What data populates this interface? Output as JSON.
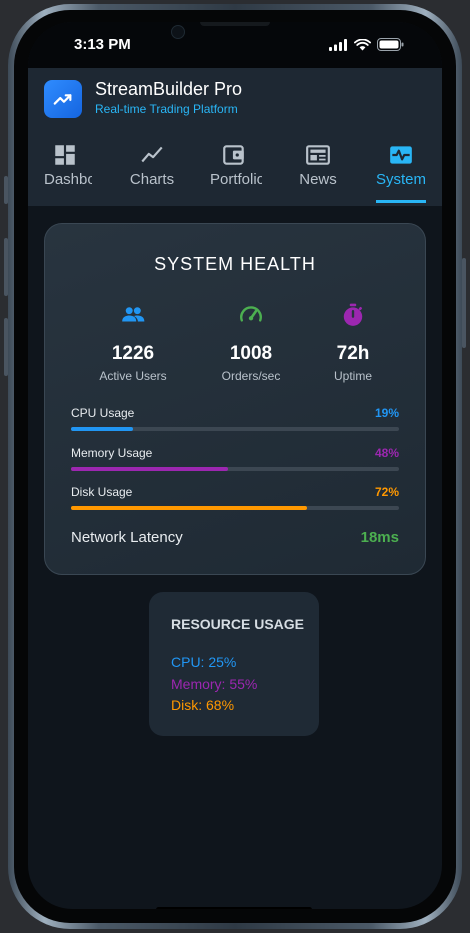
{
  "status_bar": {
    "time": "3:13 PM"
  },
  "app": {
    "title": "StreamBuilder Pro",
    "subtitle": "Real-time Trading Platform"
  },
  "tabs": [
    {
      "label": "Dashboard",
      "icon": "dashboard-icon"
    },
    {
      "label": "Charts",
      "icon": "line-chart-icon"
    },
    {
      "label": "Portfolio",
      "icon": "wallet-icon"
    },
    {
      "label": "News",
      "icon": "newspaper-icon"
    },
    {
      "label": "System",
      "icon": "monitor-heartbeat-icon",
      "active": true
    }
  ],
  "system_health": {
    "title": "SYSTEM HEALTH",
    "stats": [
      {
        "value": "1226",
        "label": "Active Users",
        "icon": "people-icon",
        "color": "#2196f3"
      },
      {
        "value": "1008",
        "label": "Orders/sec",
        "icon": "speedometer-icon",
        "color": "#4caf50"
      },
      {
        "value": "72h",
        "label": "Uptime",
        "icon": "timer-icon",
        "color": "#9c27b0"
      }
    ],
    "metrics": [
      {
        "label": "CPU Usage",
        "value": "19%",
        "percent": 19,
        "color": "#2196f3"
      },
      {
        "label": "Memory Usage",
        "value": "48%",
        "percent": 48,
        "color": "#9c27b0"
      },
      {
        "label": "Disk Usage",
        "value": "72%",
        "percent": 72,
        "color": "#ff9800"
      }
    ],
    "latency": {
      "label": "Network Latency",
      "value": "18ms",
      "color": "#4caf50"
    }
  },
  "resource_usage": {
    "title": "RESOURCE USAGE",
    "lines": [
      {
        "text": "CPU: 25%",
        "color": "#2196f3"
      },
      {
        "text": "Memory: 55%",
        "color": "#9c27b0"
      },
      {
        "text": "Disk: 68%",
        "color": "#ff9800"
      }
    ]
  }
}
